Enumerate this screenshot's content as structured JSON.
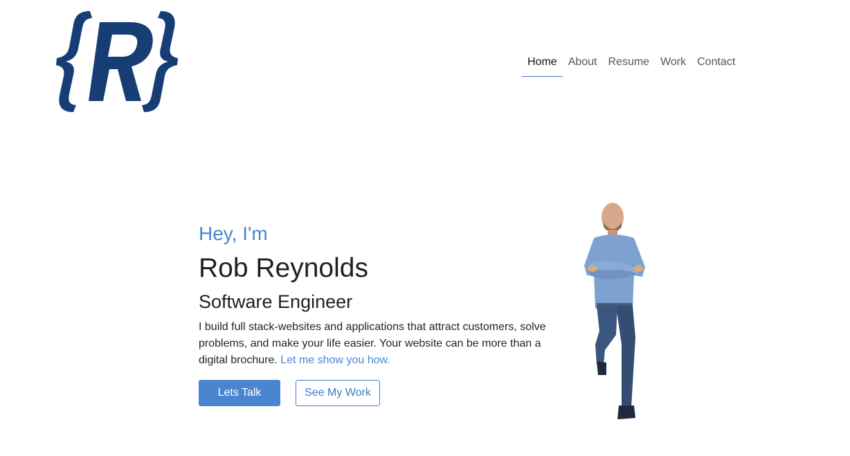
{
  "logo": {
    "alt": "{R}",
    "color": "#163e75"
  },
  "nav": {
    "items": [
      {
        "label": "Home",
        "active": true
      },
      {
        "label": "About",
        "active": false
      },
      {
        "label": "Resume",
        "active": false
      },
      {
        "label": "Work",
        "active": false
      },
      {
        "label": "Contact",
        "active": false
      }
    ]
  },
  "hero": {
    "greeting": "Hey, I'm",
    "name": "Rob Reynolds",
    "title": "Software Engineer",
    "description": "I build full stack-websites and applications that attract customers, solve problems, and make your life easier. Your website can be more than a digital brochure.",
    "link_text": "Let me show you how.",
    "primary_button": "Lets Talk",
    "secondary_button": "See My Work"
  },
  "colors": {
    "accent": "#4a86d0",
    "logo": "#163e75",
    "text": "#212529"
  }
}
